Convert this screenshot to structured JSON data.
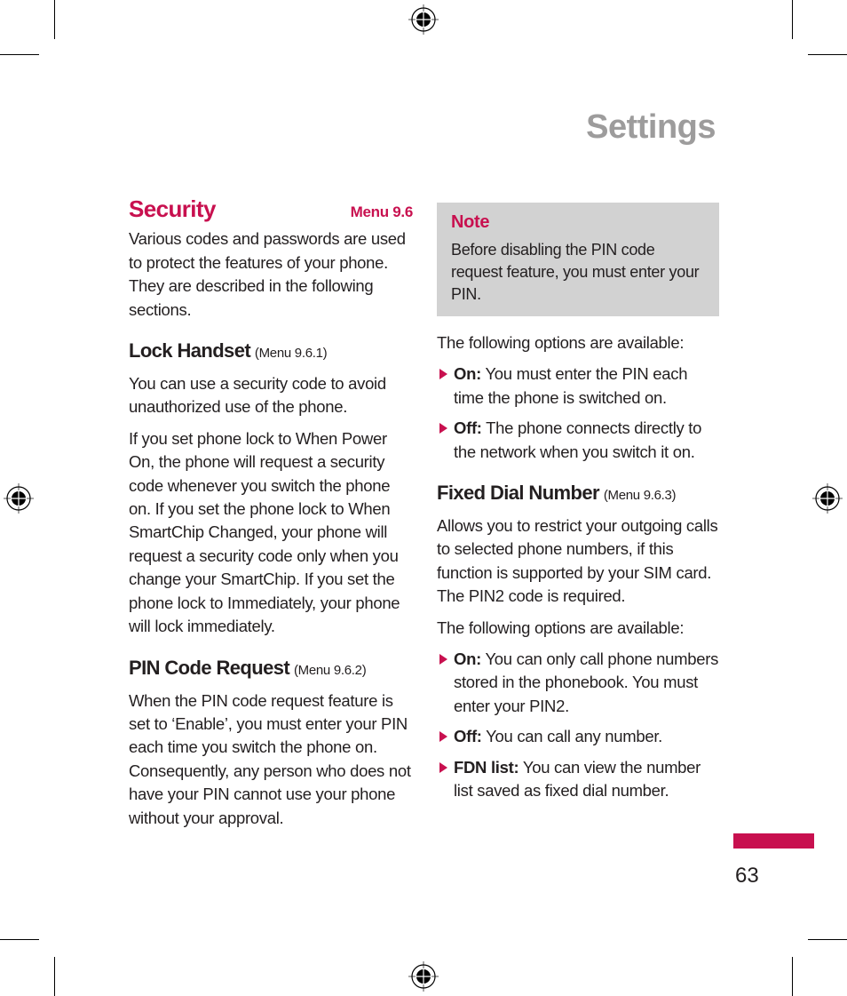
{
  "header": {
    "title": "Settings"
  },
  "security": {
    "title": "Security",
    "menu": "Menu 9.6",
    "intro": "Various codes and passwords are used to protect the features of your phone. They are described in the following sections."
  },
  "lock_handset": {
    "title": "Lock Handset",
    "menu": "(Menu 9.6.1)",
    "paragraphs": [
      "You can use a security code to avoid unauthorized use of the phone.",
      "If you set phone lock to When Power On, the phone will request a security code whenever you switch the phone on. If you set the phone lock to When SmartChip Changed, your phone will request a security code only when you change your SmartChip. If you set the phone lock to Immediately, your phone will lock immediately."
    ]
  },
  "pin_code_request": {
    "title": "PIN Code Request",
    "menu": "(Menu 9.6.2)",
    "paragraph": "When the PIN code request feature is set to ‘Enable’, you must enter your PIN each time you switch the phone on. Consequently, any person who does not have your PIN cannot use your phone without your approval."
  },
  "note": {
    "title": "Note",
    "text": "Before disabling the PIN code request feature, you must enter your PIN."
  },
  "pin_options": {
    "intro": "The following options are available:",
    "items": [
      {
        "label": "On:",
        "text": " You must enter the PIN each time the phone is switched on."
      },
      {
        "label": "Off:",
        "text": " The phone connects directly to the network when you switch it on."
      }
    ]
  },
  "fixed_dial_number": {
    "title": "Fixed Dial Number",
    "menu": "(Menu 9.6.3)",
    "paragraph": "Allows you to restrict your outgoing calls to selected phone numbers, if this function is supported by your SIM card. The PIN2 code is required.",
    "options_intro": "The following options are available:",
    "items": [
      {
        "label": "On:",
        "text": " You can only call phone numbers stored in the phonebook. You must enter your PIN2."
      },
      {
        "label": "Off:",
        "text": " You can call any number."
      },
      {
        "label": "FDN list:",
        "text": " You can view the number list saved as fixed dial number."
      }
    ]
  },
  "footer": {
    "page_number": "63"
  },
  "colors": {
    "accent": "#c8104f",
    "title_gray": "#9d9c9c",
    "note_bg": "#d2d2d2",
    "text": "#231f20"
  }
}
